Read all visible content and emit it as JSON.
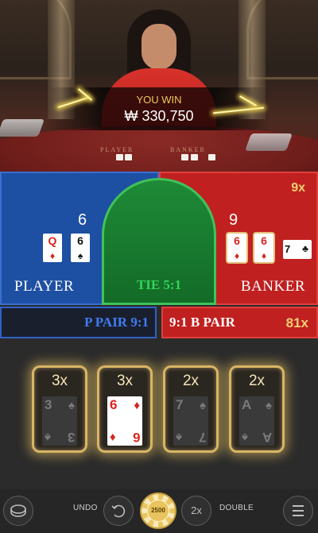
{
  "win": {
    "label": "YOU WIN",
    "amount": "₩ 330,750"
  },
  "table_text": {
    "player": "PLAYER",
    "banker": "BANKER"
  },
  "player": {
    "label": "PLAYER",
    "score": "6",
    "cards": [
      {
        "rank": "Q",
        "suit": "♦",
        "color": "#d8241f"
      },
      {
        "rank": "6",
        "suit": "♠",
        "color": "#111111"
      }
    ]
  },
  "banker": {
    "label": "BANKER",
    "score": "9",
    "multiplier": "9x",
    "cards": [
      {
        "rank": "6",
        "suit": "♦",
        "color": "#d8241f"
      },
      {
        "rank": "6",
        "suit": "♦",
        "color": "#d8241f"
      },
      {
        "rank": "7",
        "suit": "♣",
        "color": "#111111"
      }
    ]
  },
  "tie": {
    "label": "TIE 5:1"
  },
  "pairs": {
    "player_pair": "P PAIR 9:1",
    "banker_pair": "9:1 B PAIR",
    "multiplier": "81x"
  },
  "side_bets": [
    {
      "multiplier": "3x",
      "rank": "3",
      "suit": "♠",
      "active": false
    },
    {
      "multiplier": "3x",
      "rank": "6",
      "suit": "♦",
      "active": true
    },
    {
      "multiplier": "2x",
      "rank": "7",
      "suit": "♠",
      "active": false
    },
    {
      "multiplier": "2x",
      "rank": "A",
      "suit": "♠",
      "active": false
    }
  ],
  "controls": {
    "undo": "UNDO",
    "double": "DOUBLE",
    "double_badge": "2x",
    "chip_value": "2500",
    "undo_icon": "undo-arrow-icon",
    "menu_icon": "hamburger-icon",
    "chips_icon": "chip-stack-icon"
  },
  "colors": {
    "player": "#1d4fa3",
    "banker": "#c0201f",
    "tie": "#1e8a37",
    "gold": "#f2cf74"
  }
}
